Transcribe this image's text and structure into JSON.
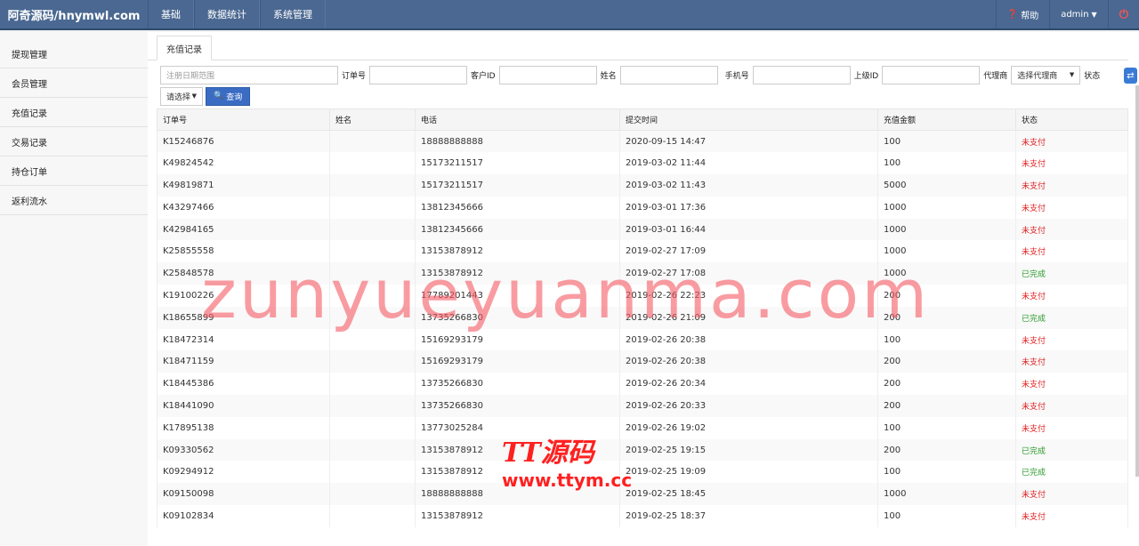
{
  "brand": "阿奇源码/hnymwl.com",
  "topnav": [
    "基础",
    "数据统计",
    "系统管理"
  ],
  "help": "帮助",
  "user": "admin",
  "sidebar": [
    "提现管理",
    "会员管理",
    "充值记录",
    "交易记录",
    "持仓订单",
    "返利流水"
  ],
  "tab": "充值记录",
  "filters": {
    "date_placeholder": "注册日期范围",
    "order_label": "订单号",
    "customer_label": "客户ID",
    "name_label": "姓名",
    "phone_label": "手机号",
    "upline_label": "上级ID",
    "agent_label": "代理商",
    "agent_select": "选择代理商",
    "status_label": "状态",
    "status_select": "请选择",
    "search_btn": "查询"
  },
  "columns": [
    "订单号",
    "姓名",
    "电话",
    "提交时间",
    "充值金额",
    "状态"
  ],
  "rows": [
    {
      "order": "K15246876",
      "name": "",
      "phone": "18888888888",
      "time": "2020-09-15 14:47",
      "amount": "100",
      "status": "未支付"
    },
    {
      "order": "K49824542",
      "name": "",
      "phone": "15173211517",
      "time": "2019-03-02 11:44",
      "amount": "100",
      "status": "未支付"
    },
    {
      "order": "K49819871",
      "name": "",
      "phone": "15173211517",
      "time": "2019-03-02 11:43",
      "amount": "5000",
      "status": "未支付"
    },
    {
      "order": "K43297466",
      "name": "",
      "phone": "13812345666",
      "time": "2019-03-01 17:36",
      "amount": "1000",
      "status": "未支付"
    },
    {
      "order": "K42984165",
      "name": "",
      "phone": "13812345666",
      "time": "2019-03-01 16:44",
      "amount": "1000",
      "status": "未支付"
    },
    {
      "order": "K25855558",
      "name": "",
      "phone": "13153878912",
      "time": "2019-02-27 17:09",
      "amount": "1000",
      "status": "未支付"
    },
    {
      "order": "K25848578",
      "name": "",
      "phone": "13153878912",
      "time": "2019-02-27 17:08",
      "amount": "1000",
      "status": "已完成"
    },
    {
      "order": "K19100226",
      "name": "",
      "phone": "17789201443",
      "time": "2019-02-26 22:23",
      "amount": "200",
      "status": "未支付"
    },
    {
      "order": "K18655899",
      "name": "",
      "phone": "13735266830",
      "time": "2019-02-26 21:09",
      "amount": "200",
      "status": "已完成"
    },
    {
      "order": "K18472314",
      "name": "",
      "phone": "15169293179",
      "time": "2019-02-26 20:38",
      "amount": "100",
      "status": "未支付"
    },
    {
      "order": "K18471159",
      "name": "",
      "phone": "15169293179",
      "time": "2019-02-26 20:38",
      "amount": "200",
      "status": "未支付"
    },
    {
      "order": "K18445386",
      "name": "",
      "phone": "13735266830",
      "time": "2019-02-26 20:34",
      "amount": "200",
      "status": "未支付"
    },
    {
      "order": "K18441090",
      "name": "",
      "phone": "13735266830",
      "time": "2019-02-26 20:33",
      "amount": "200",
      "status": "未支付"
    },
    {
      "order": "K17895138",
      "name": "",
      "phone": "13773025284",
      "time": "2019-02-26 19:02",
      "amount": "100",
      "status": "未支付"
    },
    {
      "order": "K09330562",
      "name": "",
      "phone": "13153878912",
      "time": "2019-02-25 19:15",
      "amount": "200",
      "status": "已完成"
    },
    {
      "order": "K09294912",
      "name": "",
      "phone": "13153878912",
      "time": "2019-02-25 19:09",
      "amount": "100",
      "status": "已完成"
    },
    {
      "order": "K09150098",
      "name": "",
      "phone": "18888888888",
      "time": "2019-02-25 18:45",
      "amount": "1000",
      "status": "未支付"
    },
    {
      "order": "K09102834",
      "name": "",
      "phone": "13153878912",
      "time": "2019-02-25 18:37",
      "amount": "100",
      "status": "未支付"
    }
  ],
  "watermark_main": "zunyueyuanma.com",
  "watermark_logo": "TT源码",
  "watermark_url": "www.ttym.cc",
  "colors": {
    "topbar": "#4a6891",
    "unpaid": "#e02020",
    "done": "#2a9a2a",
    "button": "#3a6cc4"
  }
}
